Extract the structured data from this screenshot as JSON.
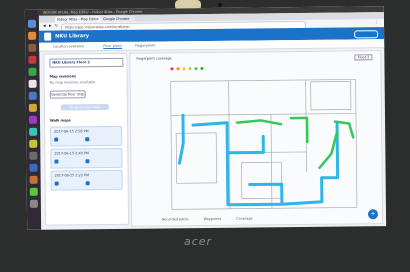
{
  "photo": {
    "device_logo": "acer",
    "bezel_color": "#2b2e2c"
  },
  "system": {
    "top_bar_text": "INDOOR ATLAS: Map Editor - Indoor Atlas - Google Chrome"
  },
  "browser": {
    "tabs": [
      {
        "label": "Indoor Atlas - Map Editor"
      },
      {
        "label": "Google Chrome"
      }
    ],
    "url": "https://app.indooratlas.com/locations/..."
  },
  "app": {
    "title": "NKU Library",
    "tabs": [
      {
        "label": "Location overview",
        "active": false
      },
      {
        "label": "Floor plans",
        "active": true
      },
      {
        "label": "Fingerprints",
        "active": false
      }
    ]
  },
  "side_panel": {
    "floor_select": "NKU Library Floor 2",
    "map_revisions_heading": "Map revisions",
    "map_revisions_sub": "No map revisions available",
    "generate_button": "Generate floor map",
    "secondary_button": "Re-generate maps",
    "walk_heading": "Walk maps",
    "walks": [
      {
        "time": "2017-06-15 2:58 PM"
      },
      {
        "time": "2017-06-15 2:40 PM"
      },
      {
        "time": "2017-06-15 2:22 PM"
      }
    ]
  },
  "map": {
    "toolbar_label": "Fingerprint coverage",
    "coverage_colors": [
      "#e0402a",
      "#f08a2a",
      "#f0c62a",
      "#a8d43a",
      "#4cc94a",
      "#2aaa4c"
    ],
    "legend": [
      "Recorded paths",
      "Waypoints",
      "Coverage"
    ],
    "path_color": "#2fb6e8",
    "path_color_secondary": "#34c85a",
    "zoom_label": "Floor 2"
  }
}
